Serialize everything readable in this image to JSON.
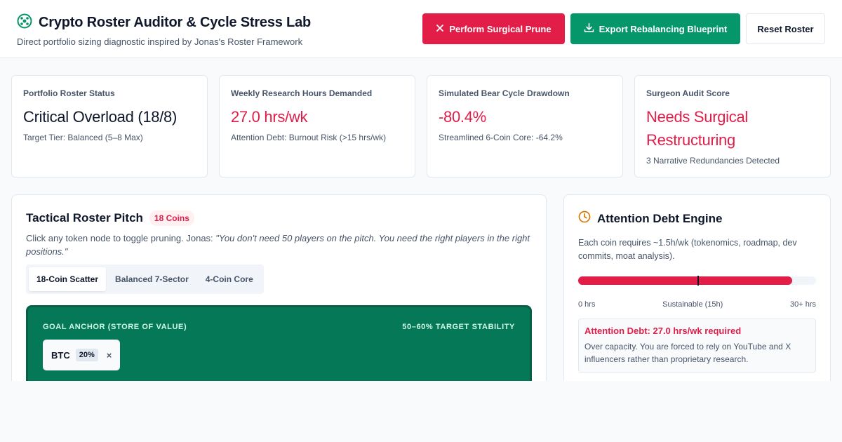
{
  "header": {
    "title": "Crypto Roster Auditor & Cycle Stress Lab",
    "subtitle": "Direct portfolio sizing diagnostic inspired by Jonas's Roster Framework",
    "logo_icon": "roster-logo-icon",
    "buttons": {
      "prune": "Perform Surgical Prune",
      "export": "Export Rebalancing Blueprint",
      "reset": "Reset Roster"
    }
  },
  "stats": [
    {
      "label": "Portfolio Roster Status",
      "value": "Critical Overload (18/8)",
      "note": "Target Tier: Balanced (5–8 Max)"
    },
    {
      "label": "Weekly Research Hours Demanded",
      "value": "27.0 hrs/wk",
      "note": "Attention Debt: Burnout Risk (>15 hrs/wk)"
    },
    {
      "label": "Simulated Bear Cycle Drawdown",
      "value": "-80.4%",
      "note": "Streamlined 6-Coin Core: -64.2%"
    },
    {
      "label": "Surgeon Audit Score",
      "value": "Needs Surgical Restructuring",
      "note": "3 Narrative Redundancies Detected"
    }
  ],
  "pitch": {
    "title": "Tactical Roster Pitch",
    "badge": "18 Coins",
    "desc_prefix": "Click any token node to toggle pruning. Jonas: ",
    "desc_quote": "\"You don't need 50 players on the pitch. You need the right players in the right positions.\"",
    "tabs": [
      "18-Coin Scatter",
      "Balanced 7-Sector",
      "4-Coin Core"
    ],
    "active_tab": 0,
    "zone": {
      "label": "GOAL ANCHOR (STORE OF VALUE)",
      "target": "50–60% TARGET STABILITY",
      "tokens": [
        {
          "symbol": "BTC",
          "pct": "20%",
          "remove": "×"
        }
      ]
    }
  },
  "attention": {
    "title": "Attention Debt Engine",
    "desc": "Each coin requires ~1.5h/wk (tokenomics, roadmap, dev commits, moat analysis).",
    "hours": 27.0,
    "max_hours": 30,
    "scale_labels": [
      "0 hrs",
      "Sustainable (15h)",
      "30+ hrs"
    ],
    "alert_title": "Attention Debt: 27.0 hrs/wk required",
    "alert_text": "Over capacity. You are forced to rely on YouTube and X influencers rather than proprietary research."
  },
  "colors": {
    "accent_red": "#e11d48",
    "accent_green": "#059669",
    "pitch_green": "#047857",
    "clock_orange": "#d97706"
  }
}
